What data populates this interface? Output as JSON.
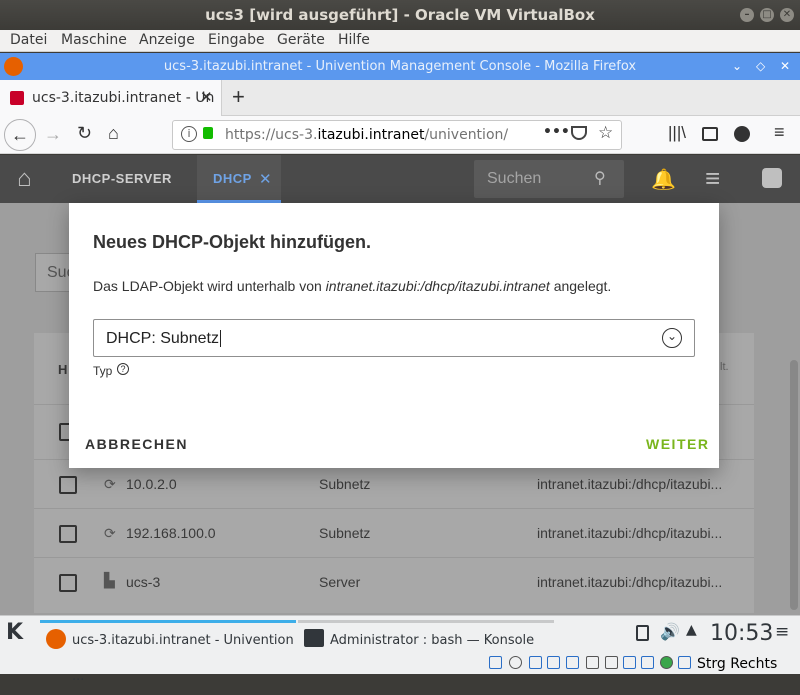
{
  "vbox": {
    "title": "ucs3 [wird ausgeführt] - Oracle VM VirtualBox",
    "menu": [
      "Datei",
      "Maschine",
      "Anzeige",
      "Eingabe",
      "Geräte",
      "Hilfe"
    ]
  },
  "firefox": {
    "title": "ucs-3.itazubi.intranet - Univention Management Console - Mozilla Firefox",
    "tab_label": "ucs-3.itazubi.intranet - Un",
    "url_prefix": "https://ucs-3.",
    "url_host": "itazubi.intranet",
    "url_path": "/univention/mar"
  },
  "umc": {
    "tabs": [
      "DHCP-SERVER",
      "DHCP"
    ],
    "search_placeholder": "Suchen",
    "bg_search_partial": "Suc",
    "col_head_partial": "H",
    "col_head_right_partial": "lt.",
    "rows": [
      {
        "name": "10.0.2.0",
        "type": "Subnetz",
        "path": "intranet.itazubi:/dhcp/itazubi..."
      },
      {
        "name": "192.168.100.0",
        "type": "Subnetz",
        "path": "intranet.itazubi:/dhcp/itazubi..."
      },
      {
        "name": "ucs-3",
        "type": "Server",
        "path": "intranet.itazubi:/dhcp/itazubi..."
      }
    ]
  },
  "dialog": {
    "title": "Neues DHCP-Objekt hinzufügen.",
    "text_prefix": "Das LDAP-Objekt wird unterhalb von ",
    "text_path": "intranet.itazubi:/dhcp/itazubi.intranet",
    "text_suffix": " angelegt.",
    "select_value": "DHCP: Subnetz",
    "select_label": "Typ",
    "cancel": "ABBRECHEN",
    "next": "WEITER"
  },
  "taskbar": {
    "task1": "ucs-3.itazubi.intranet - Univention ...",
    "task2": "Administrator : bash — Konsole",
    "clock": "10:53",
    "host_key": "Strg Rechts"
  },
  "colors": {
    "accent_green": "#7ab51d",
    "header_blue": "#5b98ee",
    "umc_active_tab": "#4f86c6"
  }
}
